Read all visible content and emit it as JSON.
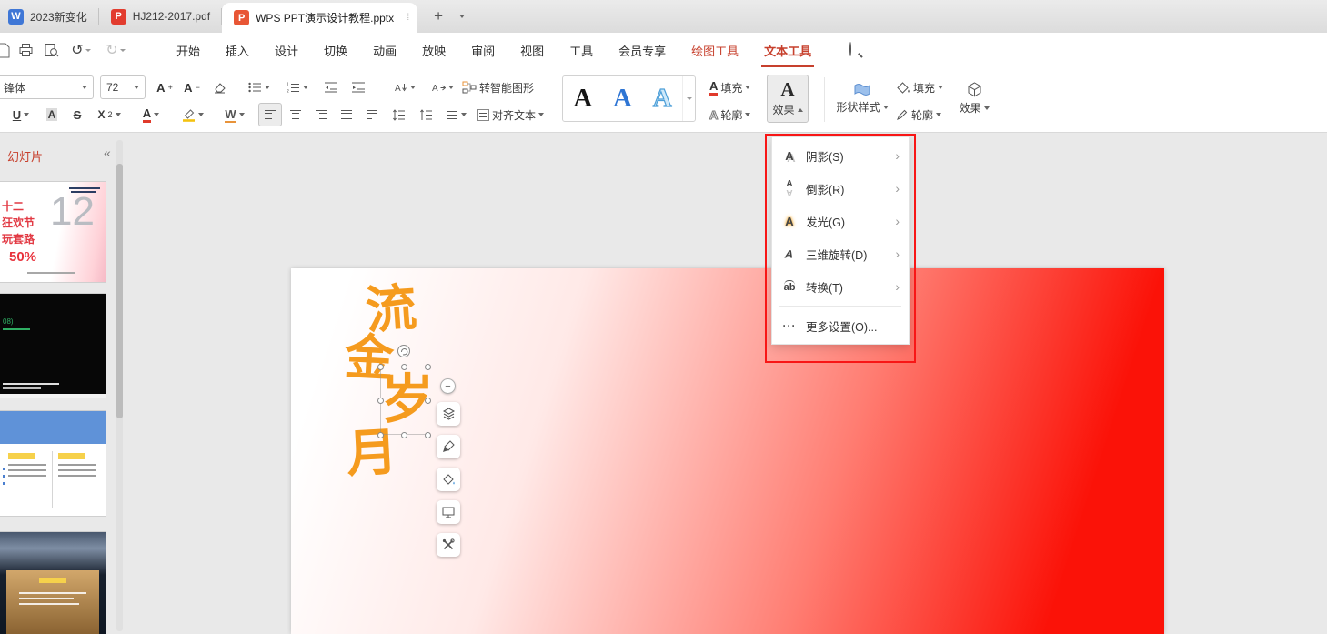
{
  "glyphs": {
    "a": "A",
    "ab": "ab",
    "u": "U",
    "s": "S",
    "x": "X",
    "sup2": "2",
    "w": "W",
    "plus": "+",
    "minus": "−",
    "dots": "···",
    "chevron": "›",
    "undo": "↺",
    "redo": "↻",
    "collapse": "«",
    "tab_dots": "⁞"
  },
  "tabbar": {
    "tabs": [
      {
        "label": "2023新变化"
      },
      {
        "label": "HJ212-2017.pdf"
      },
      {
        "label": "WPS PPT演示设计教程.pptx"
      }
    ],
    "pdf_badge": "P",
    "ppt_badge": "P",
    "doc_badge": "W"
  },
  "menubar": {
    "items": [
      "开始",
      "插入",
      "设计",
      "切换",
      "动画",
      "放映",
      "审阅",
      "视图",
      "工具",
      "会员专享"
    ],
    "draw_tools": "绘图工具",
    "text_tools": "文本工具"
  },
  "ribbon": {
    "font_name": "锋体",
    "font_size": "72",
    "smart_graphic": "转智能图形",
    "align_text": "对齐文本",
    "text_fill": "填充",
    "text_outline": "轮廓",
    "text_effects": "效果",
    "shape_styles": "形状样式",
    "shape_fill": "填充",
    "shape_outline": "轮廓",
    "shape_effects": "效果"
  },
  "effects_menu": {
    "items": [
      {
        "label": "阴影(S)"
      },
      {
        "label": "倒影(R)"
      },
      {
        "label": "发光(G)"
      },
      {
        "label": "三维旋转(D)"
      },
      {
        "label": "转换(T)"
      }
    ],
    "more_label": "更多设置(O)..."
  },
  "slides_panel": {
    "title": "幻灯片",
    "slide1": {
      "l1": "十二",
      "l2": "狂欢节",
      "l3": "玩套路",
      "pct": "50%",
      "big": "12"
    },
    "slide2": {
      "tag": "08)"
    }
  },
  "canvas": {
    "char1": "流",
    "char2": "金",
    "char3": "岁",
    "char4": "月"
  }
}
